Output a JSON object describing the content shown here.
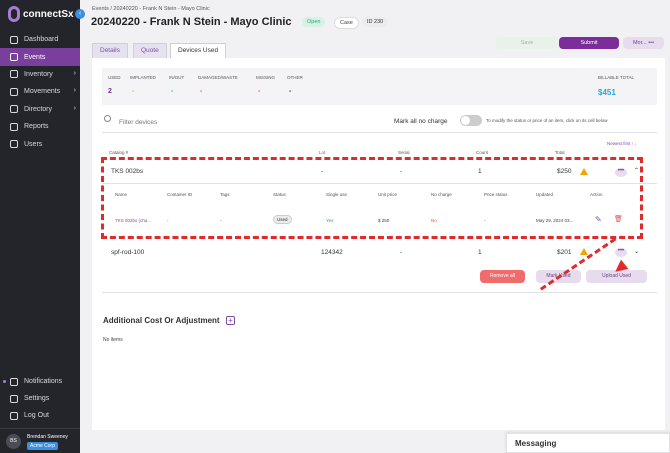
{
  "sidebar": {
    "logo": "connectSx",
    "logo_sub": "tagline text",
    "items": [
      {
        "label": "Dashboard",
        "icon": "dashboard-icon"
      },
      {
        "label": "Events",
        "icon": "calendar-icon",
        "active": true
      },
      {
        "label": "Inventory",
        "icon": "box-icon",
        "chevron": "›"
      },
      {
        "label": "Movements",
        "icon": "truck-icon",
        "chevron": "›"
      },
      {
        "label": "Directory",
        "icon": "book-icon",
        "chevron": "›"
      },
      {
        "label": "Reports",
        "icon": "report-icon"
      },
      {
        "label": "Users",
        "icon": "users-icon"
      }
    ],
    "bottom": [
      {
        "label": "Notifications",
        "icon": "bell-icon"
      },
      {
        "label": "Settings",
        "icon": "gear-icon"
      },
      {
        "label": "Log Out",
        "icon": "logout-icon"
      }
    ],
    "user": {
      "initials": "BS",
      "name": "Brendan Sweeney",
      "org": "Acme Corp"
    }
  },
  "header": {
    "breadcrumb": "Events / 20240220 - Frank N Stein - Mayo Clinic",
    "title": "20240220 - Frank N Stein - Mayo Clinic",
    "status": "Open",
    "case": "Case",
    "id": "ID 230",
    "save": "Save",
    "submit": "Submit",
    "more": "Mor... •••"
  },
  "tabs": [
    "Details",
    "Quote",
    "Devices Used"
  ],
  "stats": [
    {
      "label": "USED",
      "value": "2",
      "color": "#7b2e9a"
    },
    {
      "label": "IMPLANTED",
      "value": "-",
      "color": "#f0a500"
    },
    {
      "label": "IN/OUT",
      "value": "-",
      "color": "#2fb0a0"
    },
    {
      "label": "DAMAGED/WASTE",
      "value": "-",
      "color": "#e05050"
    },
    {
      "label": "MISSING",
      "value": "-",
      "color": "#e05050"
    },
    {
      "label": "OTHER",
      "value": "-",
      "color": "#333333"
    }
  ],
  "billable": {
    "label": "BILLABLE TOTAL",
    "value": "$451",
    "color": "#2aa7d8"
  },
  "filter": {
    "placeholder": "Filter devices",
    "mark_all": "Mark all no charge",
    "hint": "To modify the status or price of an item, click on its cell below",
    "sort": "Newest first ↑↓"
  },
  "columns": [
    "Catalog #",
    "Lot",
    "Serial",
    "Count",
    "Total"
  ],
  "rows": [
    {
      "catalog": "TKS 002bs",
      "lot": "-",
      "serial": "-",
      "count": "1",
      "total": "$250"
    },
    {
      "catalog": "spf-rod-100",
      "lot": "124342",
      "serial": "-",
      "count": "1",
      "total": "$201"
    }
  ],
  "sub_columns": [
    "Name",
    "Container ID",
    "Tags",
    "Status",
    "Single use",
    "Unit price",
    "No charge",
    "Price status",
    "Updated",
    "Action"
  ],
  "sub_row": {
    "name": "TKS 002bs (cha...",
    "container": "-",
    "tags": "-",
    "status": "Used",
    "single_use": "Yes",
    "unit_price": "$ 250",
    "no_charge": "No",
    "price_status": "-",
    "updated": "May 29, 2024 03..."
  },
  "actions": {
    "remove_all": "Remove all",
    "mark_used": "Mark Used",
    "upload_used": "Upload Used"
  },
  "additional": {
    "title": "Additional Cost Or Adjustment",
    "empty": "No items"
  },
  "messaging": "Messaging"
}
